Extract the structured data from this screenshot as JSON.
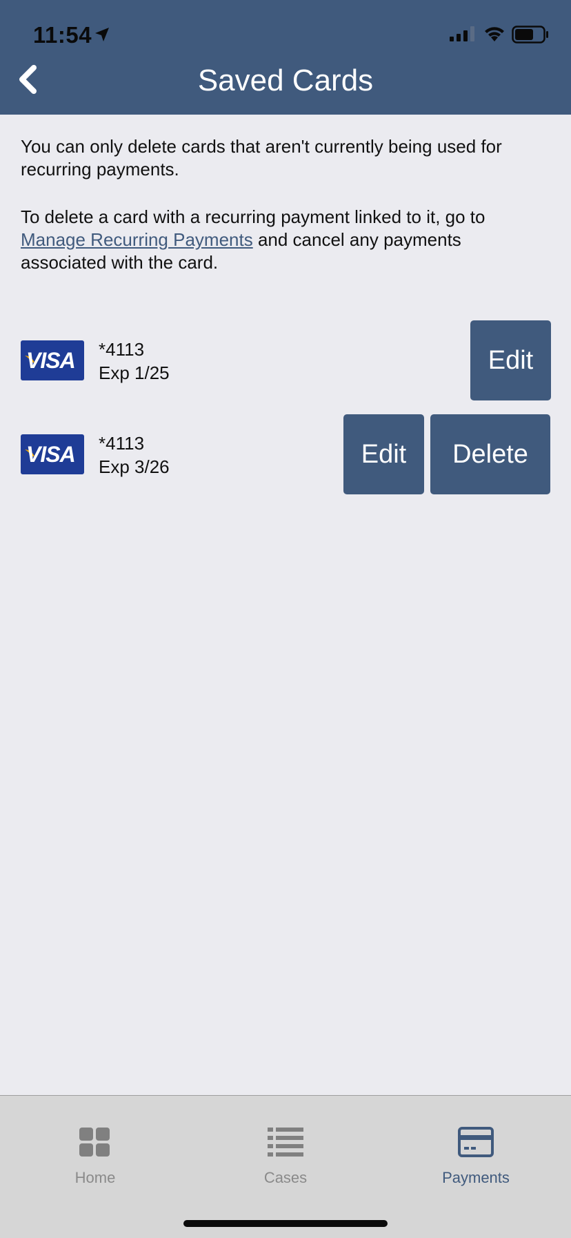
{
  "status_bar": {
    "time": "11:54"
  },
  "header": {
    "title": "Saved Cards"
  },
  "info": {
    "paragraph1": "You can only delete cards that aren't currently being used for recurring payments.",
    "paragraph2_before": "To delete a card with a recurring payment linked to it, go to ",
    "paragraph2_link": "Manage Recurring Payments",
    "paragraph2_after": " and cancel any payments associated with the card."
  },
  "cards": [
    {
      "brand": "VISA",
      "number": "*4113",
      "expiry": "Exp 1/25",
      "edit_label": "Edit"
    },
    {
      "brand": "VISA",
      "number": "*4113",
      "expiry": "Exp 3/26",
      "edit_label": "Edit",
      "delete_label": "Delete"
    }
  ],
  "tabs": [
    {
      "label": "Home",
      "icon": "grid-icon",
      "active": false
    },
    {
      "label": "Cases",
      "icon": "list-icon",
      "active": false
    },
    {
      "label": "Payments",
      "icon": "credit-card-icon",
      "active": true
    }
  ],
  "colors": {
    "brand": "#405a7d",
    "background": "#ebebf0",
    "tabbar": "#d6d6d6",
    "inactive_tab": "#8a8a8a",
    "visa_blue": "#1f3c96"
  }
}
